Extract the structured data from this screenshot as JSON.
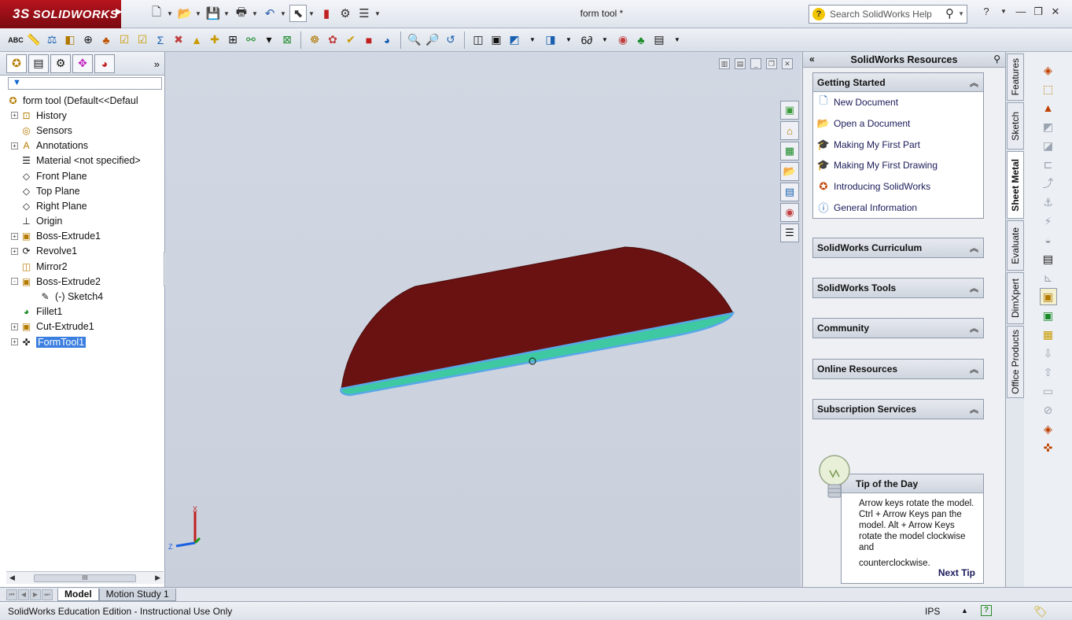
{
  "app": {
    "brand_ds": "3S",
    "brand": "SOLIDWORKS",
    "document_title": "form tool *",
    "search_placeholder": "Search SolidWorks Help"
  },
  "icons": {
    "quick_access": [
      "new-icon",
      "open-icon",
      "save-icon",
      "print-icon",
      "undo-icon",
      "select-icon",
      "rebuild-icon",
      "options-icon",
      "customize-icon"
    ],
    "command_bar": [
      "spelling-icon",
      "measure-icon",
      "mass-props-icon",
      "section-icon",
      "check-icon",
      "import-icon",
      "sim-icon",
      "costing-icon",
      "sum-icon",
      "geometry-icon",
      "draft-icon",
      "undercut-icon",
      "parting-icon",
      "thickness-icon",
      "symmetry-icon",
      "feature-works-icon",
      "performance-icon",
      "analysis-icon",
      "compare-icon",
      "render-icon",
      "zoom-fit-icon",
      "zoom-area-icon",
      "previous-view-icon",
      "section-view-icon",
      "view-orient-icon",
      "display-style-icon",
      "hide-show-icon",
      "appearance-icon",
      "scene-icon",
      "display-manager-icon"
    ]
  },
  "feature_tree": {
    "tabs": [
      "feature-manager-icon",
      "property-manager-icon",
      "config-manager-icon",
      "dimxpert-icon",
      "display-manager-icon"
    ],
    "filter": "",
    "root_label": "form tool  (Default<<Defaul",
    "items": [
      {
        "label": "History",
        "expander": "+",
        "icon": "history-icon",
        "indent": 1
      },
      {
        "label": "Sensors",
        "expander": "",
        "icon": "sensors-icon",
        "indent": 1
      },
      {
        "label": "Annotations",
        "expander": "+",
        "icon": "annotations-icon",
        "indent": 1
      },
      {
        "label": "Material <not specified>",
        "expander": "",
        "icon": "material-icon",
        "indent": 1
      },
      {
        "label": "Front Plane",
        "expander": "",
        "icon": "plane-icon",
        "indent": 1
      },
      {
        "label": "Top Plane",
        "expander": "",
        "icon": "plane-icon",
        "indent": 1
      },
      {
        "label": "Right Plane",
        "expander": "",
        "icon": "plane-icon",
        "indent": 1
      },
      {
        "label": "Origin",
        "expander": "",
        "icon": "origin-icon",
        "indent": 1
      },
      {
        "label": "Boss-Extrude1",
        "expander": "+",
        "icon": "extrude-icon",
        "indent": 1
      },
      {
        "label": "Revolve1",
        "expander": "+",
        "icon": "revolve-icon",
        "indent": 1
      },
      {
        "label": "Mirror2",
        "expander": "",
        "icon": "mirror-icon",
        "indent": 1
      },
      {
        "label": "Boss-Extrude2",
        "expander": "-",
        "icon": "extrude-icon",
        "indent": 1
      },
      {
        "label": "(-) Sketch4",
        "expander": "",
        "icon": "sketch-icon",
        "indent": 2
      },
      {
        "label": "Fillet1",
        "expander": "",
        "icon": "fillet-icon",
        "indent": 1
      },
      {
        "label": "Cut-Extrude1",
        "expander": "+",
        "icon": "cut-extrude-icon",
        "indent": 1
      },
      {
        "label": "FormTool1",
        "expander": "+",
        "icon": "form-tool-icon",
        "indent": 1,
        "selected": true
      }
    ],
    "scroll_thumb": "III"
  },
  "graphics": {
    "triad": {
      "x_label": "X",
      "z_label": "Z"
    },
    "view_tools": [
      "view-palette-icon",
      "home-icon",
      "3d-content-icon",
      "design-library-icon",
      "file-explorer-icon",
      "view-palette2-icon",
      "appearances-icon",
      "custom-properties-icon"
    ],
    "colors": {
      "body": "#6a1212",
      "face": "#3fc9a2",
      "edge": "#58a8e8"
    }
  },
  "bottom_tabs": {
    "items": [
      "Model",
      "Motion Study 1"
    ],
    "active": "Model"
  },
  "status": {
    "message": "SolidWorks Education Edition - Instructional Use Only",
    "units": "IPS",
    "help": "?"
  },
  "task_pane": {
    "title": "SolidWorks Resources",
    "getting_started": {
      "title": "Getting Started",
      "items": [
        {
          "label": "New Document",
          "icon": "new-document-icon"
        },
        {
          "label": "Open a Document",
          "icon": "open-document-icon"
        },
        {
          "label": "Making My First Part",
          "icon": "tutorial-icon"
        },
        {
          "label": "Making My First Drawing",
          "icon": "tutorial-icon"
        },
        {
          "label": "Introducing SolidWorks",
          "icon": "intro-icon"
        },
        {
          "label": "General Information",
          "icon": "info-icon"
        }
      ]
    },
    "sections": [
      "SolidWorks Curriculum",
      "SolidWorks Tools",
      "Community",
      "Online Resources",
      "Subscription Services"
    ],
    "tip": {
      "title": "Tip of the Day",
      "text1": "Arrow keys rotate the model. Ctrl + Arrow Keys pan the model. Alt + Arrow Keys rotate the model clockwise and",
      "text2": "counterclockwise.",
      "next": "Next Tip"
    }
  },
  "side_tabs": [
    "Features",
    "Sketch",
    "Sheet Metal",
    "Evaluate",
    "DimXpert",
    "Office Products"
  ],
  "active_side_tab": "Sheet Metal"
}
